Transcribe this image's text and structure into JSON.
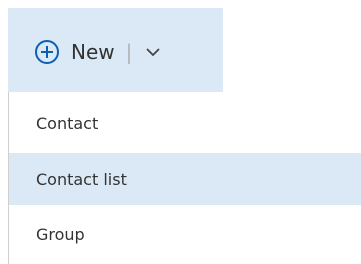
{
  "toolbar": {
    "new_label": "New",
    "separator": "|",
    "icons": {
      "plus": "circle-plus-icon",
      "dropdown": "chevron-down-icon"
    }
  },
  "menu": {
    "items": [
      {
        "label": "Contact"
      },
      {
        "label": "Contact list",
        "highlighted": true
      },
      {
        "label": "Group"
      }
    ]
  },
  "colors": {
    "highlight_background": "#dbe8f6",
    "accent": "#0a5fb4",
    "text": "#333333",
    "divider": "#cfcfcf"
  }
}
